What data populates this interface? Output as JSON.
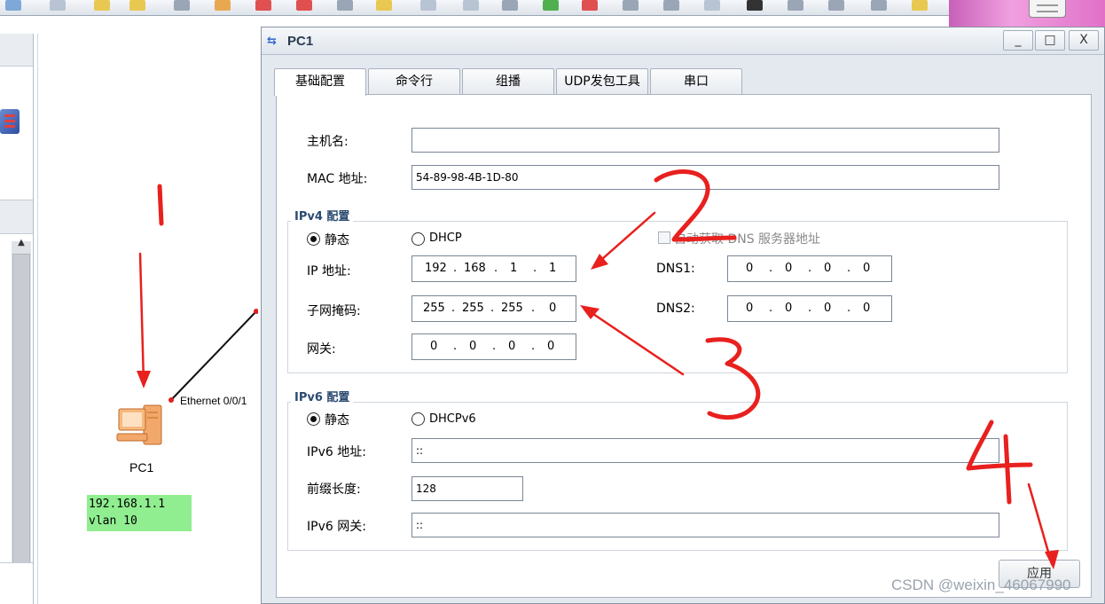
{
  "window": {
    "title": "PC1",
    "minimize": "_",
    "maximize": "□",
    "close": "X"
  },
  "tabs": [
    "基础配置",
    "命令行",
    "组播",
    "UDP发包工具",
    "串口"
  ],
  "basic": {
    "hostname_label": "主机名:",
    "hostname_value": "",
    "mac_label": "MAC 地址:",
    "mac_value": "54-89-98-4B-1D-80"
  },
  "ipv4": {
    "group_title": "IPv4 配置",
    "static_label": "静态",
    "dhcp_label": "DHCP",
    "dns_auto_label": "自动获取 DNS 服务器地址",
    "ip_label": "IP 地址:",
    "ip_octets": [
      "192",
      "168",
      "1",
      "1"
    ],
    "mask_label": "子网掩码:",
    "mask_octets": [
      "255",
      "255",
      "255",
      "0"
    ],
    "gateway_label": "网关:",
    "gateway_octets": [
      "0",
      "0",
      "0",
      "0"
    ],
    "dns1_label": "DNS1:",
    "dns1_octets": [
      "0",
      "0",
      "0",
      "0"
    ],
    "dns2_label": "DNS2:",
    "dns2_octets": [
      "0",
      "0",
      "0",
      "0"
    ]
  },
  "ipv6": {
    "group_title": "IPv6 配置",
    "static_label": "静态",
    "dhcp_label": "DHCPv6",
    "addr_label": "IPv6 地址:",
    "addr_value": "::",
    "prefix_label": "前缀长度:",
    "prefix_value": "128",
    "gateway_label": "IPv6 网关:",
    "gateway_value": "::"
  },
  "apply_label": "应用",
  "topology": {
    "pc_label": "PC1",
    "port_label": "Ethernet 0/0/1",
    "note_lines": [
      "192.168.1.1",
      "vlan 10"
    ]
  },
  "annotations": [
    "1",
    "2",
    "3",
    "4"
  ],
  "watermark": "CSDN @weixin_46067990",
  "colors": {
    "annotation": "#e8201e",
    "note_bg": "#90ee90",
    "group_title": "#2b4a70"
  }
}
